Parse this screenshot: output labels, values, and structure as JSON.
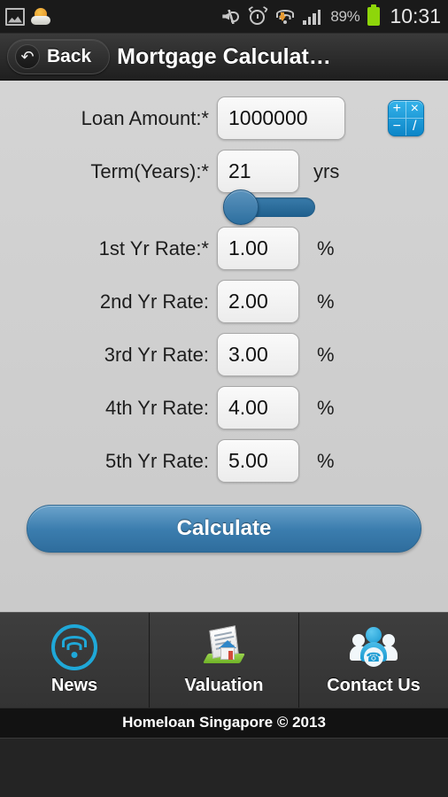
{
  "statusbar": {
    "left_icons": [
      "screenshot-icon",
      "weather-icon"
    ],
    "right_icons": [
      "mute-icon",
      "alarm-icon",
      "wifi-download-icon",
      "signal-icon"
    ],
    "battery_percent": "89%",
    "clock": "10:31"
  },
  "titlebar": {
    "back_label": "Back",
    "back_icon": "undo-arrow-icon",
    "title": "Mortgage Calculat…"
  },
  "form": {
    "loan": {
      "label": "Loan Amount:*",
      "value": "1000000",
      "placeholder": "Loan Amount"
    },
    "term": {
      "label": "Term(Years):*",
      "value": "21",
      "placeholder": "Years",
      "unit": "yrs",
      "slider_value": 21
    },
    "rates": [
      {
        "label": "1st Yr Rate:*",
        "value": "1.00",
        "unit": "%",
        "placeholder": "Rate"
      },
      {
        "label": "2nd Yr Rate:",
        "value": "2.00",
        "unit": "%",
        "placeholder": "Rate"
      },
      {
        "label": "3rd Yr Rate:",
        "value": "3.00",
        "unit": "%",
        "placeholder": "Rate"
      },
      {
        "label": "4th Yr Rate:",
        "value": "4.00",
        "unit": "%",
        "placeholder": "Rate"
      },
      {
        "label": "5th Yr Rate:",
        "value": "5.00",
        "unit": "%",
        "placeholder": "Rate"
      }
    ],
    "calculator_icon": {
      "name": "calculator-icon",
      "glyphs": [
        "+",
        "×",
        "−",
        "/"
      ]
    },
    "submit_label": "Calculate"
  },
  "bottomnav": {
    "tabs": [
      {
        "label": "News",
        "icon": "rss-signal-icon"
      },
      {
        "label": "Valuation",
        "icon": "document-house-icon"
      },
      {
        "label": "Contact Us",
        "icon": "people-phone-icon"
      }
    ]
  },
  "footer": {
    "text": "Homeloan Singapore © 2013"
  },
  "colors": {
    "accent_blue": "#3b7dae",
    "icon_cyan": "#1fa8d8",
    "calc_icon_blue": "#0c86c8",
    "battery_green": "#8ed60a",
    "content_bg": "#cfcfcf",
    "chrome_dark": "#2b2b2b"
  }
}
